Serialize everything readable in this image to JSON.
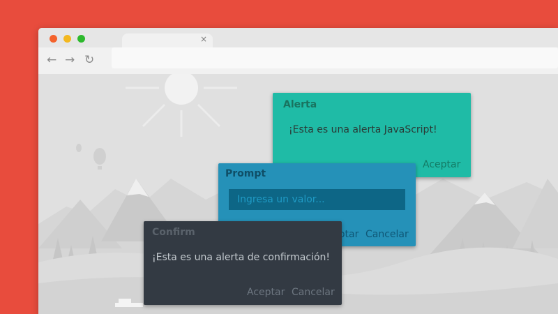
{
  "browser": {
    "tab_close": "×",
    "nav": {
      "back_icon": "←",
      "forward_icon": "→",
      "reload_icon": "↻"
    }
  },
  "dialogs": {
    "alert": {
      "title": "Alerta",
      "message": "¡Esta es una alerta JavaScript!",
      "accept": "Aceptar",
      "color": "#1fbba6"
    },
    "prompt": {
      "title": "Prompt",
      "placeholder": "Ingresa un valor...",
      "value": "",
      "accept": "Aceptar",
      "cancel": "Cancelar",
      "color": "#2591b8"
    },
    "confirm": {
      "title": "Confirm",
      "message": "¡Esta es una alerta de confirmación!",
      "accept": "Aceptar",
      "cancel": "Cancelar",
      "color": "#333a43"
    }
  },
  "colors": {
    "page_background": "#e84c3d",
    "content_background": "#e0e0e0"
  }
}
